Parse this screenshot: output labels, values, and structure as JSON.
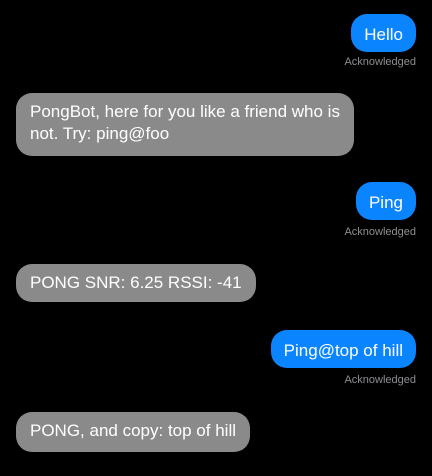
{
  "conversation": {
    "messages": [
      {
        "direction": "outgoing",
        "text": "Hello",
        "status": "Acknowledged"
      },
      {
        "direction": "incoming",
        "text": "PongBot, here for you like a friend who is not. Try: ping@foo"
      },
      {
        "direction": "outgoing",
        "text": "Ping",
        "status": "Acknowledged"
      },
      {
        "direction": "incoming",
        "text": "PONG SNR: 6.25 RSSI: -41"
      },
      {
        "direction": "outgoing",
        "text": "Ping@top of hill",
        "status": "Acknowledged"
      },
      {
        "direction": "incoming",
        "text": "PONG, and copy: top of hill"
      }
    ]
  },
  "colors": {
    "background": "#000000",
    "outgoing_bubble": "#0a84ff",
    "incoming_bubble": "#8a8a8a",
    "status_text": "#8e8e93"
  }
}
